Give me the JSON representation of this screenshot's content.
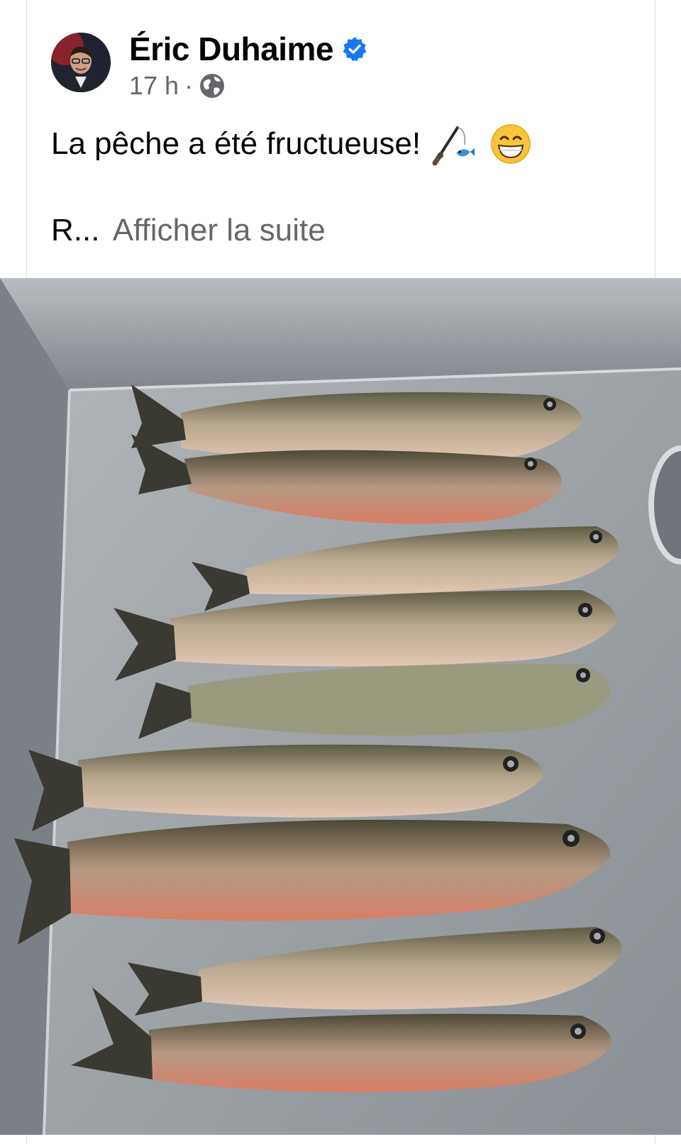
{
  "post": {
    "author_name": "Éric Duhaime",
    "time": "17 h",
    "separator": "·",
    "text": "La pêche a été fructueuse!",
    "truncated_start": "R...",
    "see_more": "Afficher la suite"
  },
  "icons": {
    "verified": "verified-badge-icon",
    "audience": "globe-icon",
    "emoji_1": "fishing-pole-emoji",
    "emoji_2": "grinning-face-emoji"
  },
  "colors": {
    "verified_blue": "#1877f2",
    "secondary_text": "#65676b",
    "primary_text": "#050505"
  },
  "photo": {
    "subject": "photo of nine trout on a stainless steel sink"
  }
}
